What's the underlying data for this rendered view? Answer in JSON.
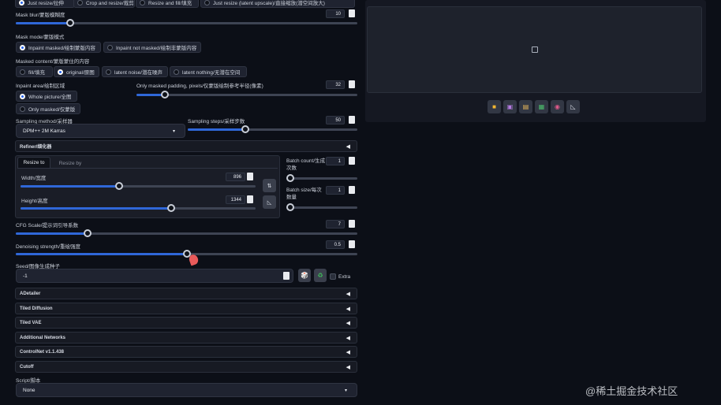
{
  "resize_mode": {
    "options": [
      "Just resize/拉伸",
      "Crop and resize/裁剪",
      "Resize and fill/填充",
      "Just resize (latent upscale)/直接缩放(潜空间放大)"
    ],
    "selected": 0
  },
  "mask_blur": {
    "label": "Mask blur/蒙版模糊度",
    "value": "10",
    "fraction": 0.16
  },
  "mask_mode": {
    "label": "Mask mode/蒙版模式",
    "options": [
      "Inpaint masked/绘制蒙版内容",
      "Inpaint not masked/绘制非蒙版内容"
    ],
    "selected": 0
  },
  "masked_content": {
    "label": "Masked content/蒙版蒙住的内容",
    "options": [
      "fill/填充",
      "original/原图",
      "latent noise/潜在噪声",
      "latent nothing/无潜在空间"
    ],
    "selected": 1
  },
  "inpaint_area": {
    "label": "Inpaint area/绘制区域",
    "options": [
      "Whole picture/全图",
      "Only masked/仅蒙版"
    ],
    "selected": 0
  },
  "only_masked_padding": {
    "label": "Only masked padding, pixels/仅蒙版绘制参考半径(像素)",
    "value": "32",
    "fraction": 0.13
  },
  "sampling_method": {
    "label": "Sampling method/采样器",
    "value": "DPM++ 2M Karras"
  },
  "sampling_steps": {
    "label": "Sampling steps/采样步数",
    "value": "50",
    "fraction": 0.34
  },
  "refiner": {
    "label": "Refiner/细化器"
  },
  "resize_tabs": [
    "Resize to",
    "Resize by"
  ],
  "width": {
    "label": "Width/宽度",
    "value": "896",
    "fraction": 0.42
  },
  "height": {
    "label": "Height/高度",
    "value": "1344",
    "fraction": 0.64
  },
  "batch_count": {
    "label": "Batch count/生成次数",
    "value": "1",
    "fraction": 0.0
  },
  "batch_size": {
    "label": "Batch size/每次数量",
    "value": "1",
    "fraction": 0.0
  },
  "cfg_scale": {
    "label": "CFG Scale/提示词引导系数",
    "value": "7",
    "fraction": 0.21
  },
  "denoising": {
    "label": "Denoising strength/重绘强度",
    "value": "0.5",
    "fraction": 0.5
  },
  "seed": {
    "label": "Seed/图像生成种子",
    "value": "-1",
    "extra": "Extra"
  },
  "accordions": [
    "ADetailer",
    "Tiled Diffusion",
    "Tiled VAE",
    "Additional Networks",
    "ControlNet v1.1.438",
    "Cutoff"
  ],
  "script": {
    "label": "Script/脚本",
    "value": "None"
  },
  "watermark": "@稀土掘金技术社区",
  "icons": {
    "swap": "swap-icon",
    "ratio": "ratio-icon",
    "dice": "dice-icon",
    "recycle": "recycle-icon",
    "tools": [
      "folder-icon",
      "save-icon",
      "zip-icon",
      "image-icon",
      "palette-icon",
      "ruler-icon"
    ]
  },
  "colors": {
    "accent": "#2f67d8",
    "bg": "#0c0f17",
    "panel": "#1a1d27"
  }
}
